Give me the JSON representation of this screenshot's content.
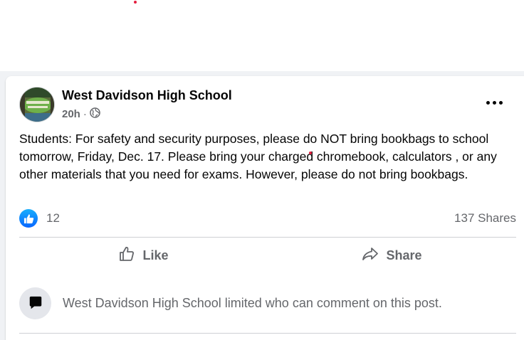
{
  "colors": {
    "like_blue": "#0866ff",
    "secondary_text": "#65676b",
    "feed_bg": "#f0f2f5",
    "notification_dot": "#e41e3f"
  },
  "post": {
    "author": "West Davidson High School",
    "time": "20h",
    "separator": "·",
    "audience_icon": "globe-icon",
    "body": "Students: For safety and security purposes, please do NOT bring bookbags to school tomorrow, Friday, Dec. 17. Please bring your charged chromebook, calculators , or any other materials that you need for exams. However, please do not bring bookbags.",
    "reactions": {
      "icon": "like-icon",
      "count": "12"
    },
    "shares": "137 Shares",
    "actions": {
      "like_label": "Like",
      "share_label": "Share"
    },
    "comment_notice": "West Davidson High School limited who can comment on this post."
  }
}
